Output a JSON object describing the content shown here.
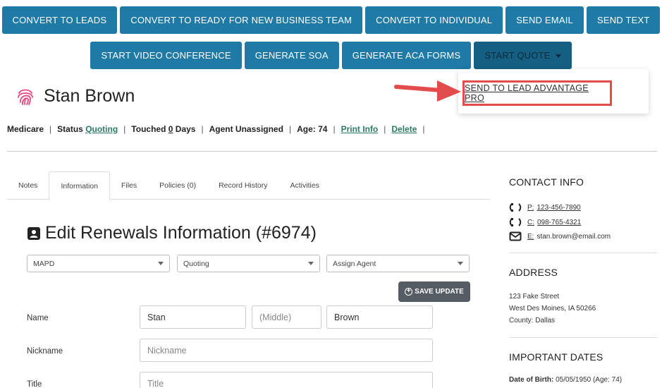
{
  "toolbar": {
    "row1": [
      "CONVERT TO LEADS",
      "CONVERT TO READY FOR NEW BUSINESS TEAM",
      "CONVERT TO INDIVIDUAL",
      "SEND EMAIL",
      "SEND TEXT"
    ],
    "row2": [
      "START VIDEO CONFERENCE",
      "GENERATE SOA",
      "GENERATE ACA FORMS",
      "START QUOTE"
    ]
  },
  "dropdown": {
    "item": "SEND TO LEAD ADVANTAGE PRO"
  },
  "contact": {
    "name": "Stan Brown"
  },
  "meta": {
    "type": "Medicare",
    "status_label": "Status",
    "status_value": "Quoting",
    "touched_label": "Touched",
    "touched_value": "0",
    "touched_unit": "Days",
    "agent": "Agent Unassigned",
    "age_label": "Age:",
    "age_value": "74",
    "print_info": "Print Info",
    "delete": "Delete",
    "sep": "|"
  },
  "tabs": [
    "Notes",
    "Information",
    "Files",
    "Policies (0)",
    "Record History",
    "Activities"
  ],
  "form": {
    "title": "Edit Renewals Information (#6974)",
    "selects": [
      "MAPD",
      "Quoting",
      "Assign Agent"
    ],
    "save_label": "SAVE UPDATE",
    "labels": {
      "name": "Name",
      "nickname": "Nickname",
      "title": "Title"
    },
    "fields": {
      "first": "Stan",
      "middle_placeholder": "(Middle)",
      "last": "Brown",
      "nickname_placeholder": "Nickname",
      "title_placeholder": "Title"
    }
  },
  "sidebar": {
    "contact_head": "CONTACT INFO",
    "phone_key": "P:",
    "phone": "123-456-7890",
    "cell_key": "C:",
    "cell": "098-765-4321",
    "email_key": "E:",
    "email": "stan.brown@email.com",
    "address_head": "ADDRESS",
    "address_lines": [
      "123 Fake Street",
      "West Des Moines, IA 50266",
      "County: Dallas"
    ],
    "dates_head": "IMPORTANT DATES",
    "dob_label": "Date of Birth:",
    "dob_value": "05/05/1950 (Age: 74)"
  },
  "colors": {
    "primary": "#1f7aa6",
    "active": "#155f82",
    "link": "#2d7a5e",
    "highlight": "#e34c4c",
    "save": "#555c63"
  }
}
